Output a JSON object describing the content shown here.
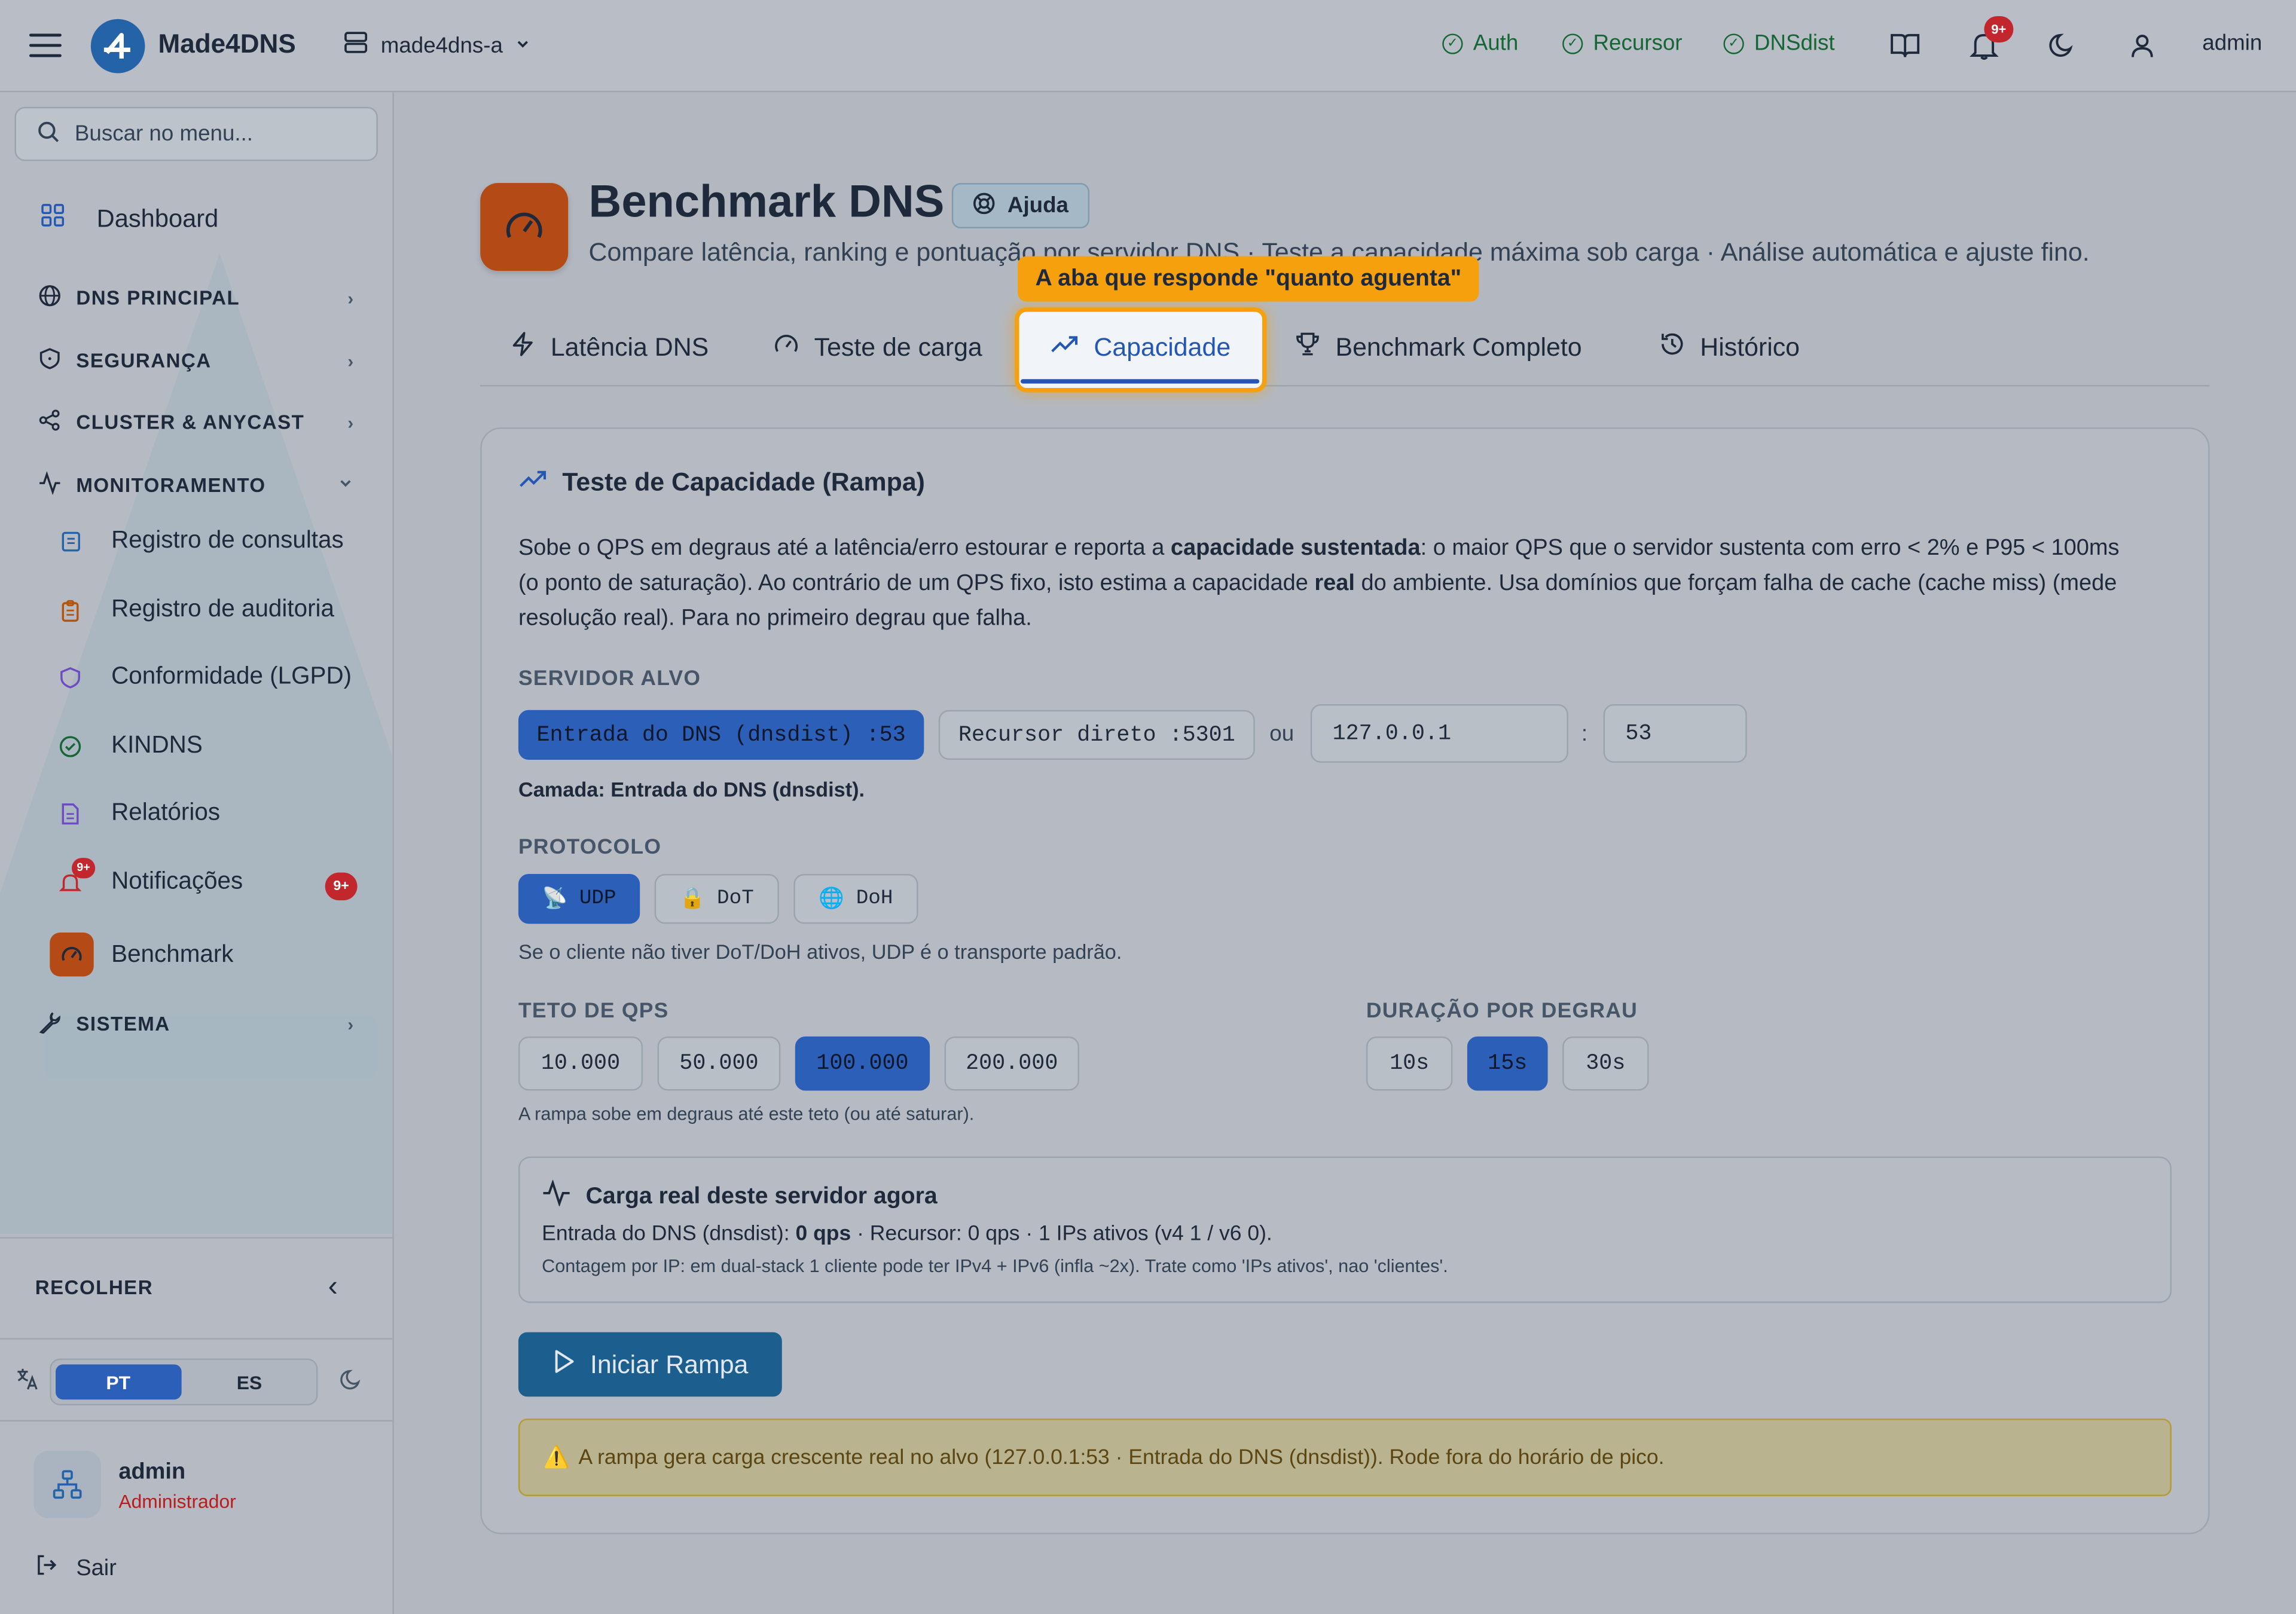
{
  "topbar": {
    "brand": "Made4DNS",
    "server": "made4dns-a",
    "services": [
      "Auth",
      "Recursor",
      "DNSdist"
    ],
    "notifications_badge": "9+",
    "user": "admin"
  },
  "sidebar": {
    "search_placeholder": "Buscar no menu...",
    "dashboard": "Dashboard",
    "sections": {
      "dns": "DNS PRINCIPAL",
      "security": "SEGURANÇA",
      "cluster": "CLUSTER & ANYCAST",
      "monitoring": "MONITORAMENTO",
      "system": "SISTEMA"
    },
    "monitoring_items": {
      "queries": "Registro de consultas",
      "audit": "Registro de auditoria",
      "lgpd": "Conformidade (LGPD)",
      "kindns": "KINDNS",
      "reports": "Relatórios",
      "notifications": "Notificações",
      "notifications_badge": "9+",
      "benchmark": "Benchmark"
    },
    "collapse": "RECOLHER",
    "lang": {
      "pt": "PT",
      "es": "ES"
    },
    "profile": {
      "name": "admin",
      "role": "Administrador"
    },
    "logout": "Sair"
  },
  "page": {
    "title": "Benchmark DNS",
    "help": "Ajuda",
    "subtitle": "Compare latência, ranking e pontuação por servidor DNS · Teste a capacidade máxima sob carga · Análise automática e ajuste fino.",
    "tooltip": "A aba que responde \"quanto aguenta\"",
    "tabs": [
      "Latência DNS",
      "Teste de carga",
      "Capacidade",
      "Benchmark Completo",
      "Histórico"
    ],
    "active_tab": "Capacidade"
  },
  "card": {
    "title": "Teste de Capacidade (Rampa)",
    "desc_1": "Sobe o QPS em degraus até a latência/erro estourar e reporta a ",
    "desc_b1": "capacidade sustentada",
    "desc_2": ": o maior QPS que o servidor sustenta com erro < 2% e P95 < 100ms (o ponto de saturação). Ao contrário de um QPS fixo, isto estima a capacidade ",
    "desc_b2": "real",
    "desc_3": " do ambiente. Usa domínios que forçam falha de cache (cache miss) (mede resolução real). Para no primeiro degrau que falha.",
    "target": {
      "label": "SERVIDOR ALVO",
      "option_dnsdist": "Entrada do DNS (dnsdist) :53",
      "option_recursor": "Recursor direto :5301",
      "or": "ou",
      "host": "127.0.0.1",
      "sep": ":",
      "port": "53",
      "layer": "Camada: Entrada do DNS (dnsdist)."
    },
    "protocol": {
      "label": "PROTOCOLO",
      "options": [
        "UDP",
        "DoT",
        "DoH"
      ],
      "selected": "UDP",
      "hint": "Se o cliente não tiver DoT/DoH ativos, UDP é o transporte padrão."
    },
    "qps": {
      "label": "TETO DE QPS",
      "options": [
        "10.000",
        "50.000",
        "100.000",
        "200.000"
      ],
      "selected": "100.000",
      "hint": "A rampa sobe em degraus até este teto (ou até saturar)."
    },
    "step": {
      "label": "DURAÇÃO POR DEGRAU",
      "options": [
        "10s",
        "15s",
        "30s"
      ],
      "selected": "15s"
    },
    "live": {
      "title": "Carga real deste servidor agora",
      "line_a": "Entrada do DNS (dnsdist): ",
      "line_qps": "0 qps",
      "line_b": " · Recursor: 0 qps · 1 IPs ativos (v4 1 / v6 0).",
      "note": "Contagem por IP: em dual-stack 1 cliente pode ter IPv4 + IPv6 (infla ~2x). Trate como 'IPs ativos', nao 'clientes'."
    },
    "start": "Iniciar Rampa",
    "warning": "A rampa gera carga crescente real no alvo (127.0.0.1:53 · Entrada do DNS (dnsdist)). Rode fora do horário de pico."
  },
  "colors": {
    "accent": "#2c5fb8",
    "highlight": "#f5a00c",
    "brand_orange": "#b44b17",
    "ok": "#166534"
  }
}
